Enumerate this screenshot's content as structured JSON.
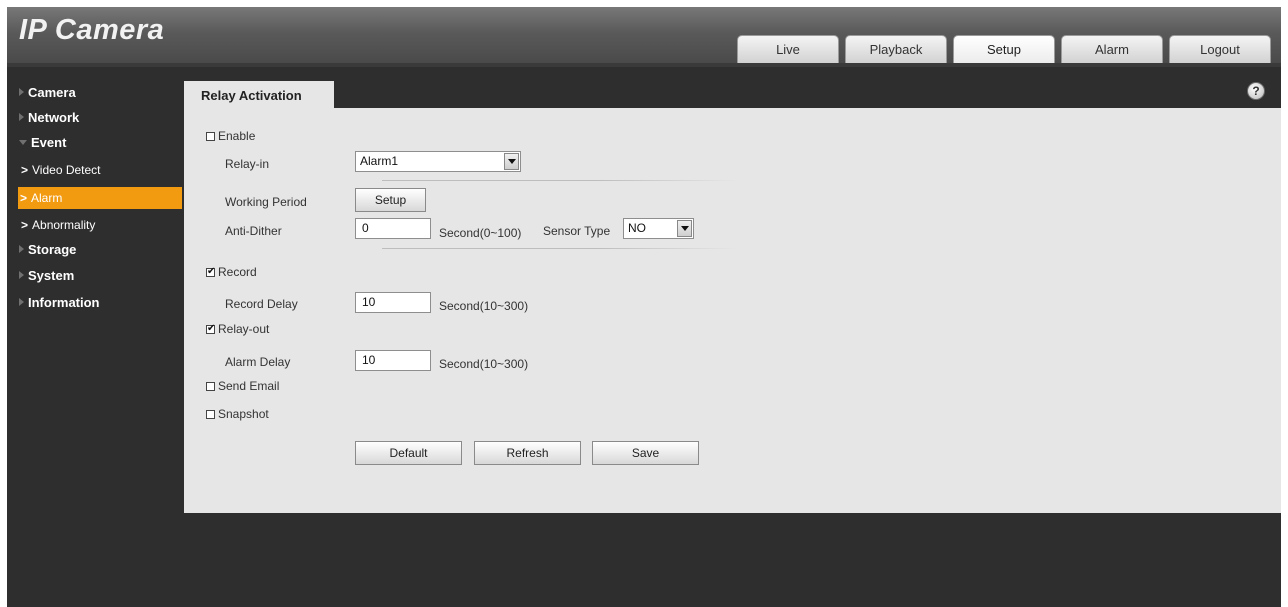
{
  "app": {
    "title": "IP Camera"
  },
  "header": {
    "tabs": [
      {
        "label": "Live",
        "active": false
      },
      {
        "label": "Playback",
        "active": false
      },
      {
        "label": "Setup",
        "active": true
      },
      {
        "label": "Alarm",
        "active": false
      },
      {
        "label": "Logout",
        "active": false
      }
    ]
  },
  "sidebar": {
    "items": [
      {
        "label": "Camera",
        "expanded": false
      },
      {
        "label": "Network",
        "expanded": false
      },
      {
        "label": "Event",
        "expanded": true
      },
      {
        "label": "Storage",
        "expanded": false
      },
      {
        "label": "System",
        "expanded": false
      },
      {
        "label": "Information",
        "expanded": false
      }
    ],
    "event_children": [
      {
        "label": "Video Detect",
        "active": false
      },
      {
        "label": "Alarm",
        "active": true
      },
      {
        "label": "Abnormality",
        "active": false
      }
    ],
    "chevron": ">"
  },
  "panel": {
    "tab_title": "Relay Activation",
    "help_symbol": "?",
    "enable": {
      "label": "Enable",
      "checked": false
    },
    "relay_in": {
      "label": "Relay-in",
      "value": "Alarm1"
    },
    "working_period": {
      "label": "Working Period",
      "button": "Setup"
    },
    "anti_dither": {
      "label": "Anti-Dither",
      "value": "0",
      "unit": "Second(0~100)"
    },
    "sensor_type": {
      "label": "Sensor Type",
      "value": "NO"
    },
    "record": {
      "label": "Record",
      "checked": true
    },
    "record_delay": {
      "label": "Record Delay",
      "value": "10",
      "unit": "Second(10~300)"
    },
    "relay_out": {
      "label": "Relay-out",
      "checked": true
    },
    "alarm_delay": {
      "label": "Alarm Delay",
      "value": "10",
      "unit": "Second(10~300)"
    },
    "send_email": {
      "label": "Send Email",
      "checked": false
    },
    "snapshot": {
      "label": "Snapshot",
      "checked": false
    },
    "buttons": {
      "default": "Default",
      "refresh": "Refresh",
      "save": "Save"
    }
  },
  "colors": {
    "accent": "#f29a10",
    "background": "#2e2e2e",
    "panel": "#e6e6e6",
    "header": "#5a5a5a"
  }
}
